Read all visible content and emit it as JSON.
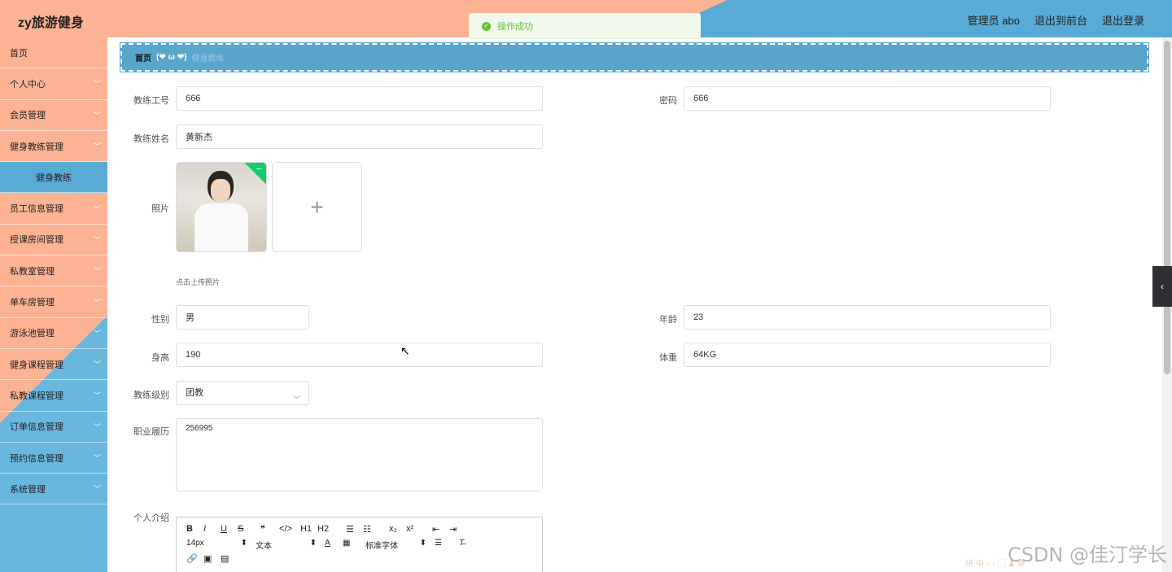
{
  "header": {
    "brand": "zy旅游健身",
    "admin": "管理员 abo",
    "back_front": "退出到前台",
    "logout": "退出登录"
  },
  "toast": {
    "message": "操作成功"
  },
  "sidebar": {
    "items": [
      {
        "label": "首页",
        "has_arrow": false
      },
      {
        "label": "个人中心",
        "has_arrow": true
      },
      {
        "label": "会员管理",
        "has_arrow": true
      },
      {
        "label": "健身教练管理",
        "has_arrow": true
      },
      {
        "label": "健身教练",
        "sub": true
      },
      {
        "label": "员工信息管理",
        "has_arrow": true
      },
      {
        "label": "授课房间管理",
        "has_arrow": true
      },
      {
        "label": "私教室管理",
        "has_arrow": true
      },
      {
        "label": "单车房管理",
        "has_arrow": true
      },
      {
        "label": "游泳池管理",
        "has_arrow": true
      },
      {
        "label": "健身课程管理",
        "has_arrow": true
      },
      {
        "label": "私教课程管理",
        "has_arrow": true
      },
      {
        "label": "订单信息管理",
        "has_arrow": true
      },
      {
        "label": "预约信息管理",
        "has_arrow": true
      },
      {
        "label": "系统管理",
        "has_arrow": true
      }
    ]
  },
  "breadcrumb": {
    "home": "首页",
    "face": "(❤ ω ❤)",
    "current": "健身教练"
  },
  "form": {
    "coach_no": {
      "label": "教练工号",
      "value": "666"
    },
    "password": {
      "label": "密码",
      "value": "666"
    },
    "coach_name": {
      "label": "教练姓名",
      "value": "黄新杰"
    },
    "photo": {
      "label": "照片",
      "upload_tip": "点击上传照片",
      "plus": "+"
    },
    "gender": {
      "label": "性别",
      "value": "男"
    },
    "age": {
      "label": "年龄",
      "value": "23"
    },
    "height": {
      "label": "身高",
      "value": "190"
    },
    "weight": {
      "label": "体重",
      "value": "64KG"
    },
    "level": {
      "label": "教练级别",
      "value": "团教"
    },
    "resume": {
      "label": "职业履历",
      "value": "256995"
    },
    "intro": {
      "label": "个人介绍"
    }
  },
  "editor": {
    "row1": [
      "B",
      "I",
      "U",
      "S",
      "❞",
      "</>",
      "H1",
      "H2",
      "☰",
      "☷",
      "x₂",
      "x²",
      "⇤",
      "⇥"
    ],
    "font_size": "14px",
    "text_type": "文本",
    "font_family": "标准字体"
  },
  "watermark": "CSDN @佳汀学长",
  "colors": {
    "peach": "#fcb393",
    "blue": "#5aaad6",
    "success": "#67c23a"
  }
}
